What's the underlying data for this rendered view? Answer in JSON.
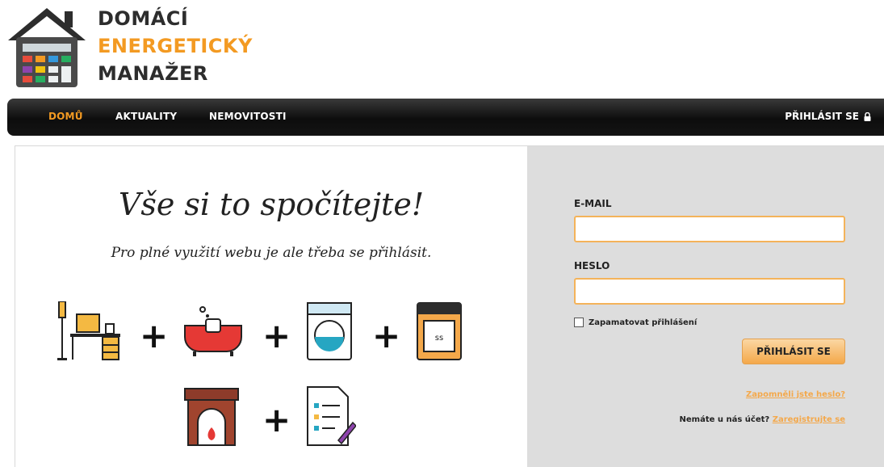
{
  "logo": {
    "line1": "DOMÁCÍ",
    "line2": "ENERGETICKÝ",
    "line3": "MANAŽER",
    "icon": "house-calculator-icon"
  },
  "nav": {
    "items": [
      {
        "label": "DOMŮ",
        "active": true
      },
      {
        "label": "AKTUALITY",
        "active": false
      },
      {
        "label": "NEMOVITOSTI",
        "active": false
      }
    ],
    "login_label": "PŘIHLÁSIT SE",
    "login_icon": "lock-icon"
  },
  "hero": {
    "title": "Vše si to spočítejte!",
    "subtitle": "Pro plné využití webu je ale třeba se přihlásit.",
    "plus": "+",
    "icons": [
      "desk-lamp-icon",
      "bathtub-icon",
      "washing-machine-icon",
      "oven-icon",
      "fireplace-icon",
      "checklist-icon"
    ]
  },
  "form": {
    "email_label": "E-MAIL",
    "email_value": "",
    "password_label": "HESLO",
    "password_value": "",
    "remember_label": "Zapamatovat přihlášení",
    "submit_label": "PŘIHLÁSIT SE",
    "forgot_label": "Zapomněli jste heslo?",
    "no_account_text": "Nemáte u nás účet?",
    "register_label": "Zaregistrujte se"
  },
  "colors": {
    "accent": "#f39a22",
    "panel_gray": "#dddddd",
    "nav_dark": "#111111"
  }
}
